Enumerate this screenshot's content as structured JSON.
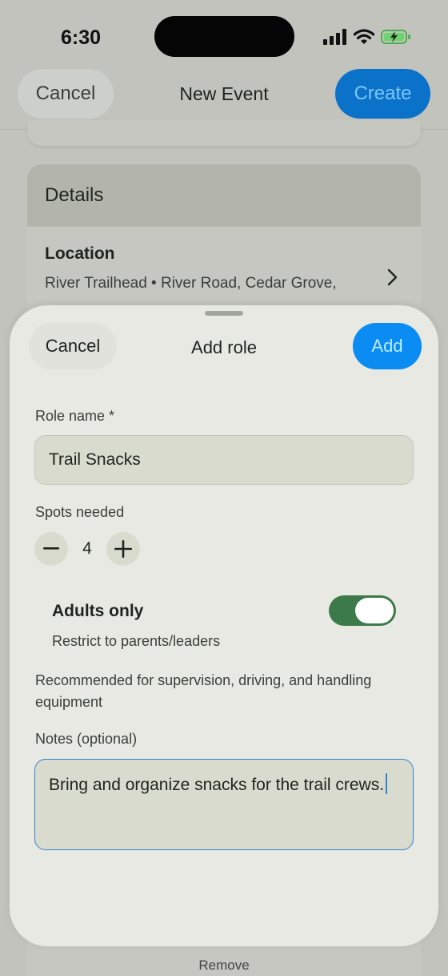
{
  "status_bar": {
    "time": "6:30"
  },
  "nav": {
    "cancel_label": "Cancel",
    "title": "New Event",
    "create_label": "Create"
  },
  "details": {
    "header": "Details",
    "location_label": "Location",
    "location_value": "River Trailhead • River Road, Cedar Grove,",
    "remove_label": "Remove"
  },
  "sheet": {
    "cancel_label": "Cancel",
    "title": "Add role",
    "add_label": "Add",
    "role_name_label": "Role name *",
    "role_name_value": "Trail Snacks",
    "spots_label": "Spots needed",
    "spots_value": "4",
    "adults_only_title": "Adults only",
    "adults_only_subtitle": "Restrict to parents/leaders",
    "adults_only_on": true,
    "help_text": "Recommended for supervision, driving, and handling equipment",
    "notes_label": "Notes (optional)",
    "notes_value": "Bring and organize snacks for the trail crews."
  },
  "colors": {
    "accent": "#0a8cf2",
    "toggle_on": "#3c7a4a"
  }
}
